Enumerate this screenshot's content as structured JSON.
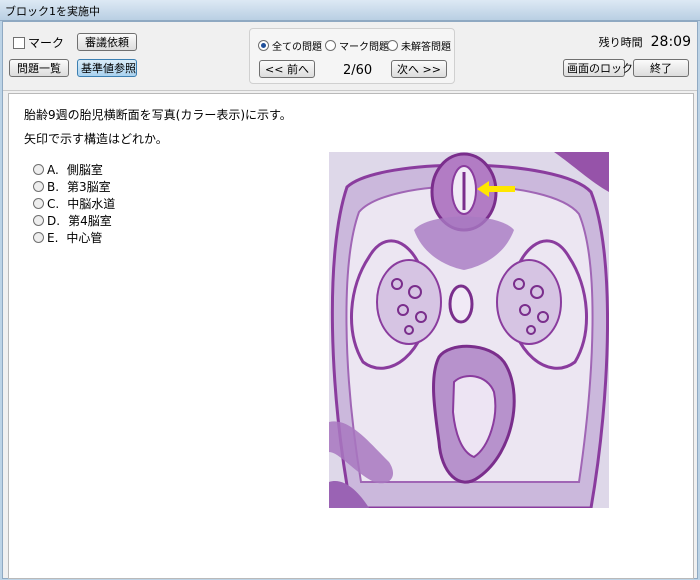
{
  "window": {
    "title": "ブロック1を実施中"
  },
  "toolbar": {
    "mark_label": "マーク",
    "deliberation_label": "審議依頼",
    "question_list_label": "問題一覧",
    "reference_label": "基準値参照",
    "filters": [
      "全ての問題",
      "マーク問題",
      "未解答問題"
    ],
    "selected_filter_index": 0,
    "prev_label": "<< 前へ",
    "counter": "2/60",
    "next_label": "次へ >>",
    "time_label": "残り時間",
    "time_value": "28:09",
    "lock_label": "画面のロック",
    "end_label": "終了"
  },
  "question": {
    "line1": "胎齢9週の胎児横断面を写真(カラー表示)に示す。",
    "line2": "矢印で示す構造はどれか。",
    "choices": [
      {
        "letter": "A.",
        "text": "側脳室"
      },
      {
        "letter": "B.",
        "text": "第3脳室"
      },
      {
        "letter": "C.",
        "text": "中脳水道"
      },
      {
        "letter": "D.",
        "text": "第4脳室"
      },
      {
        "letter": "E.",
        "text": "中心管"
      }
    ]
  },
  "colors": {
    "accent_pressed": "#a9d2ef",
    "radio_selected": "#1f4f9a",
    "arrow": "#ffe600",
    "stain": "#8a3c9e"
  },
  "icons": {
    "arrow": "arrow-left-icon"
  }
}
